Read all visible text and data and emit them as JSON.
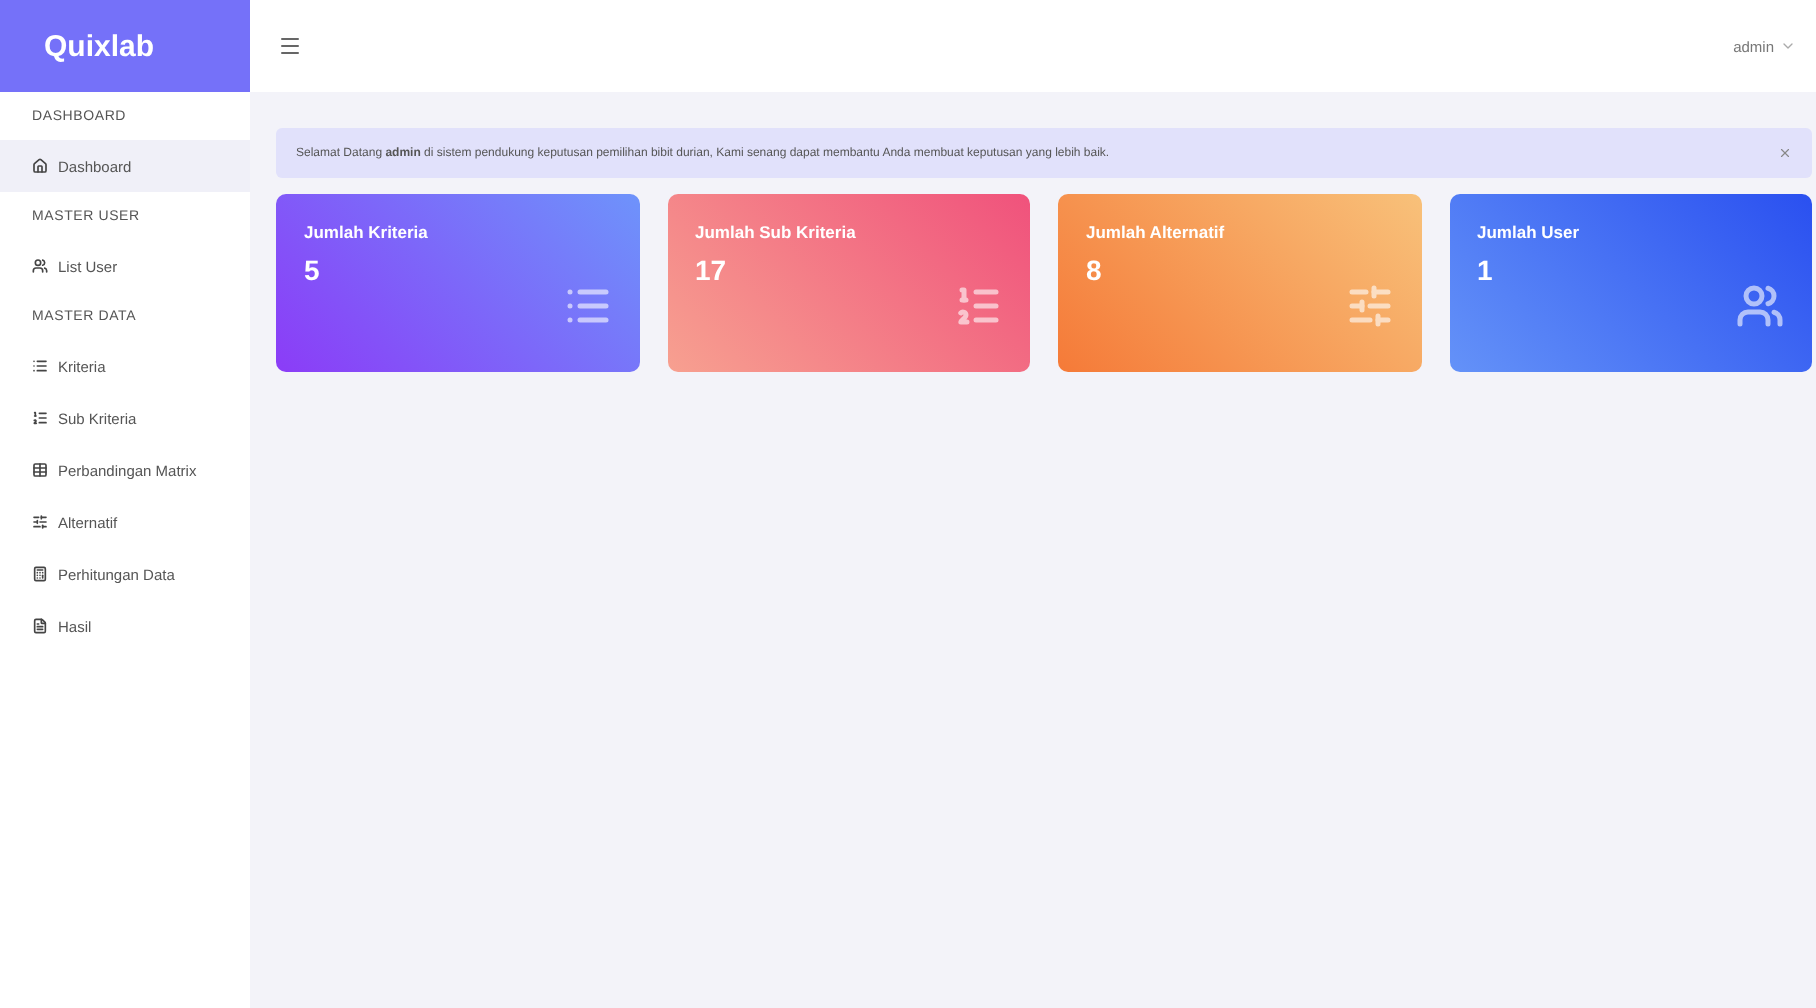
{
  "brand": "Quixlab",
  "sidebar": {
    "items": [
      {
        "kind": "heading",
        "label": "DASHBOARD"
      },
      {
        "kind": "link",
        "label": "Dashboard",
        "selected": true
      },
      {
        "kind": "heading",
        "label": "MASTER USER"
      },
      {
        "kind": "link",
        "label": "List User",
        "selected": false
      },
      {
        "kind": "heading",
        "label": "MASTER DATA"
      },
      {
        "kind": "link",
        "label": "Kriteria",
        "selected": false
      },
      {
        "kind": "link",
        "label": "Sub Kriteria",
        "selected": false
      },
      {
        "kind": "link",
        "label": "Perbandingan Matrix",
        "selected": false
      },
      {
        "kind": "link",
        "label": "Alternatif",
        "selected": false
      },
      {
        "kind": "link",
        "label": "Perhitungan Data",
        "selected": false
      },
      {
        "kind": "link",
        "label": "Hasil",
        "selected": false
      }
    ]
  },
  "topbar": {
    "user": "admin"
  },
  "alert": {
    "text": "Selamat Datang **admin** di sistem pendukung keputusan pemilihan bibit durian, Kami senang dapat membantu Anda membuat keputusan yang lebih baik."
  },
  "cards": [
    {
      "title": "Jumlah Kriteria",
      "value": "5"
    },
    {
      "title": "Jumlah Sub Kriteria",
      "value": "17"
    },
    {
      "title": "Jumlah Alternatif",
      "value": "8"
    },
    {
      "title": "Jumlah User",
      "value": "1"
    }
  ]
}
